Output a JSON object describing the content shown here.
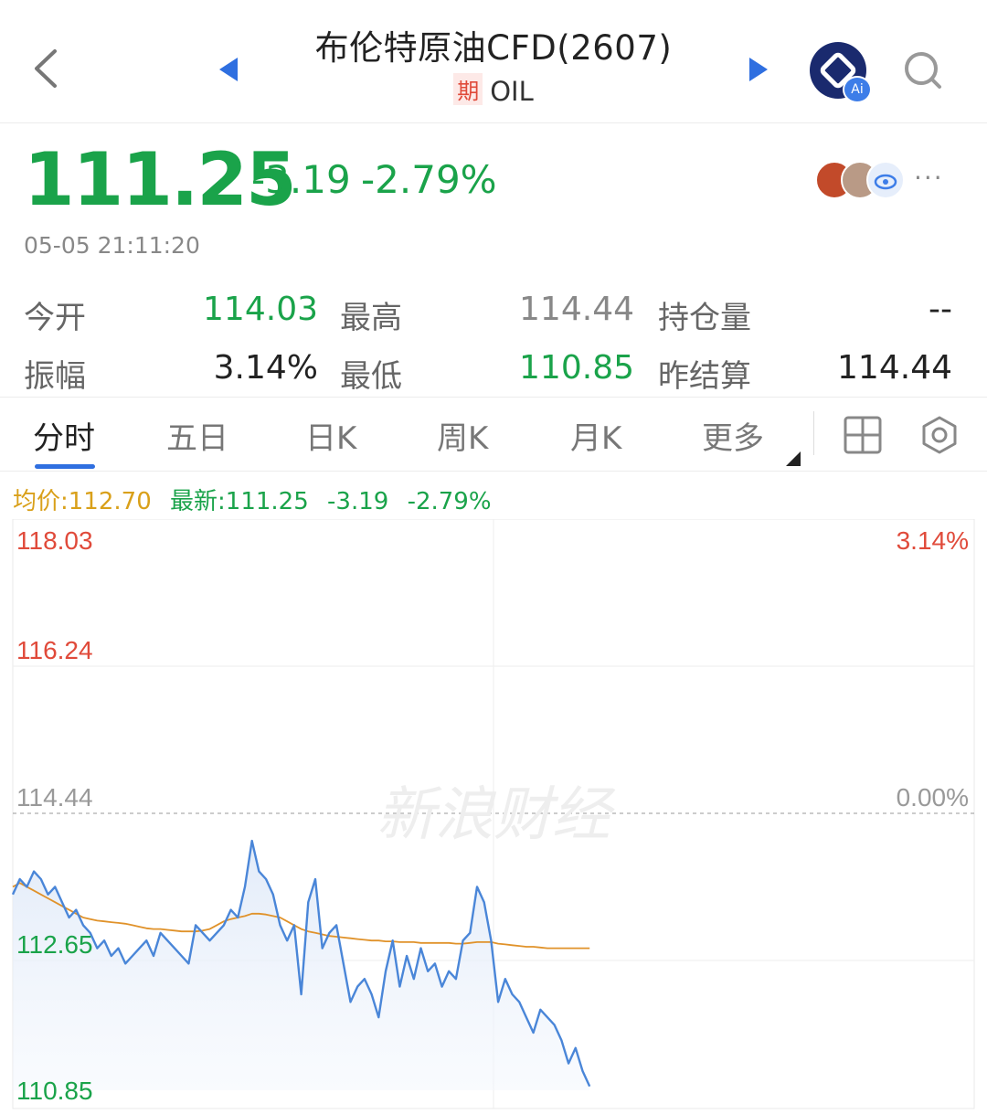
{
  "header": {
    "title": "布伦特原油CFD(2607)",
    "badge": "期",
    "symbol": "OIL",
    "ai_badge": "Ai"
  },
  "quote": {
    "price": "111.25",
    "change": "-3.19",
    "change_pct": "-2.79%",
    "time": "05-05 21:11:20",
    "more": "···"
  },
  "stats": {
    "open_label": "今开",
    "open": "114.03",
    "high_label": "最高",
    "high": "114.44",
    "oi_label": "持仓量",
    "oi": "--",
    "amp_label": "振幅",
    "amp": "3.14%",
    "low_label": "最低",
    "low": "110.85",
    "settle_label": "昨结算",
    "settle": "114.44"
  },
  "tabs": [
    "分时",
    "五日",
    "日K",
    "周K",
    "月K",
    "更多"
  ],
  "legend": {
    "avg": "均价:112.70",
    "latest": "最新:111.25",
    "change": "-3.19",
    "pct": "-2.79%"
  },
  "watermark": "新浪财经",
  "colors": {
    "up": "#e04a3a",
    "down": "#1aa34a",
    "price_line": "#4a86d8",
    "avg_line": "#e0922a",
    "accent": "#2f6fe0"
  },
  "chart_data": {
    "type": "line",
    "title": "",
    "xlabel": "",
    "ylabel": "",
    "ylim": [
      110.85,
      118.03
    ],
    "prev_settle": 114.44,
    "y_ticks": [
      "118.03",
      "116.24",
      "114.44",
      "112.65",
      "110.85"
    ],
    "right_ticks": [
      "3.14%",
      "0.00%"
    ],
    "session_fraction": 0.6,
    "series": [
      {
        "name": "最新",
        "color": "#4a86d8",
        "values": [
          113.4,
          113.6,
          113.5,
          113.7,
          113.6,
          113.4,
          113.5,
          113.3,
          113.1,
          113.2,
          113.0,
          112.9,
          112.7,
          112.8,
          112.6,
          112.7,
          112.5,
          112.6,
          112.7,
          112.8,
          112.6,
          112.9,
          112.8,
          112.7,
          112.6,
          112.5,
          113.0,
          112.9,
          112.8,
          112.9,
          113.0,
          113.2,
          113.1,
          113.5,
          114.1,
          113.7,
          113.6,
          113.4,
          113.0,
          112.8,
          113.0,
          112.1,
          113.3,
          113.6,
          112.7,
          112.9,
          113.0,
          112.5,
          112.0,
          112.2,
          112.3,
          112.1,
          111.8,
          112.4,
          112.8,
          112.2,
          112.6,
          112.3,
          112.7,
          112.4,
          112.5,
          112.2,
          112.4,
          112.3,
          112.8,
          112.9,
          113.5,
          113.3,
          112.8,
          112.0,
          112.3,
          112.1,
          112.0,
          111.8,
          111.6,
          111.9,
          111.8,
          111.7,
          111.5,
          111.2,
          111.4,
          111.1,
          110.9
        ]
      },
      {
        "name": "均价",
        "color": "#e0922a",
        "values": [
          113.5,
          113.55,
          113.5,
          113.45,
          113.4,
          113.35,
          113.3,
          113.25,
          113.2,
          113.15,
          113.1,
          113.08,
          113.06,
          113.05,
          113.04,
          113.03,
          113.02,
          113.0,
          112.98,
          112.96,
          112.95,
          112.95,
          112.94,
          112.93,
          112.92,
          112.92,
          112.92,
          112.93,
          112.95,
          113.0,
          113.05,
          113.08,
          113.1,
          113.12,
          113.15,
          113.15,
          113.14,
          113.12,
          113.1,
          113.05,
          113.0,
          112.95,
          112.92,
          112.9,
          112.88,
          112.86,
          112.85,
          112.84,
          112.83,
          112.82,
          112.81,
          112.8,
          112.8,
          112.79,
          112.79,
          112.78,
          112.78,
          112.78,
          112.77,
          112.77,
          112.77,
          112.77,
          112.77,
          112.76,
          112.76,
          112.77,
          112.78,
          112.78,
          112.78,
          112.76,
          112.75,
          112.74,
          112.73,
          112.72,
          112.72,
          112.71,
          112.7,
          112.7,
          112.7,
          112.7,
          112.7,
          112.7,
          112.7
        ]
      }
    ]
  }
}
